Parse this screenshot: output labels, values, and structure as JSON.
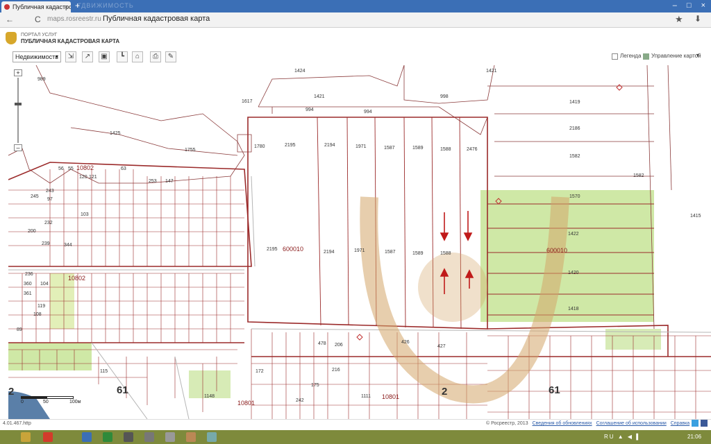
{
  "browser": {
    "tab_title": "Публичная кадастровая",
    "tab_close": "×",
    "new_tab": "+",
    "tab_ghost": "ГДВИЖИМОСТЬ",
    "url_host": "maps.rosreestr.ru",
    "page_title": "Публичная кадастровая карта",
    "back": "←",
    "reload": "C",
    "star": "★",
    "menu": "⬇",
    "win_min": "–",
    "win_max": "□",
    "win_close": "×"
  },
  "portal": {
    "small_caption": "ПОРТАЛ УСЛУГ",
    "title": "ПУБЛИЧНАЯ КАДАСТРОВАЯ КАРТА"
  },
  "toolbar": {
    "select_value": "Недвижимость",
    "select_arrow": "▾",
    "legend_label": "Легенда",
    "map_manager_label": "Управление картой",
    "map_manager_arrow": "▾",
    "tools": [
      "⇲",
      "↗",
      "▣",
      "┗",
      "⌂",
      "⎙",
      "✎"
    ]
  },
  "map": {
    "zoom_in": "+",
    "zoom_out": "–",
    "quarters": [
      "10802",
      "10802",
      "600010",
      "600010",
      "10801",
      "10801"
    ],
    "big_labels": [
      "61",
      "61",
      "2",
      "2"
    ],
    "parcels_top": [
      "1424",
      "1421",
      "1421",
      "1617",
      "994",
      "994",
      "998",
      "1419",
      "989",
      "1425",
      "1755",
      "1780",
      "2186",
      "1582",
      "1582",
      "1570",
      "1415"
    ],
    "parcels_strip": [
      "2195",
      "2194",
      "1971",
      "1587",
      "1589",
      "1588",
      "2476"
    ],
    "parcels_strip_lower": [
      "2195",
      "2194",
      "1971",
      "1587",
      "1589",
      "1588",
      "1422",
      "1420",
      "1418"
    ],
    "parcels_left": [
      "63",
      "253",
      "147",
      "245",
      "243",
      "232",
      "200",
      "344",
      "239",
      "108",
      "119",
      "236",
      "360",
      "104",
      "361",
      "89",
      "97",
      "56",
      "55",
      "120",
      "121",
      "103",
      "216",
      "172",
      "175",
      "242",
      "115",
      "1148",
      "1111",
      "206",
      "426",
      "427",
      "478"
    ],
    "scale": {
      "zero": "0",
      "fifty": "50",
      "hundred": "100м"
    }
  },
  "status": {
    "version": "4.01.467.http",
    "copyright": "© Росреестр, 2013",
    "link_updates": "Сведения об обновлениях",
    "link_terms": "Соглашение об использовании",
    "link_help": "Справка"
  },
  "taskbar": {
    "clock": "21:06",
    "tray": "RU ▲ ◀ ▌"
  },
  "colors": {
    "parcel_line": "#9b2a2a",
    "green_zone": "#cfe8a6",
    "watermark": "#d4a66a"
  }
}
